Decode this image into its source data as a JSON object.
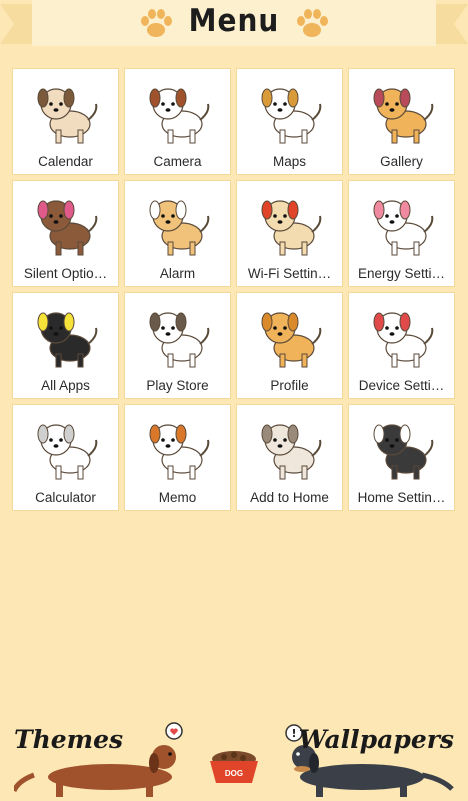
{
  "header": {
    "title": "Menu"
  },
  "tiles": [
    {
      "label": "Calendar",
      "icon": "pug-dog-icon",
      "fur": "#f1dcc0",
      "accent": "#7a5a3a"
    },
    {
      "label": "Camera",
      "icon": "papillon-dog-icon",
      "fur": "#ffffff",
      "accent": "#a0522d"
    },
    {
      "label": "Maps",
      "icon": "beagle-dog-icon",
      "fur": "#ffffff",
      "accent": "#d99a3a"
    },
    {
      "label": "Gallery",
      "icon": "shiba-dog-icon",
      "fur": "#f0b35a",
      "accent": "#b84a5a"
    },
    {
      "label": "Silent Optio…",
      "icon": "yorkie-dog-icon",
      "fur": "#8a5a3a",
      "accent": "#e05a8a"
    },
    {
      "label": "Alarm",
      "icon": "corgi-dog-icon",
      "fur": "#f0c27a",
      "accent": "#ffffff"
    },
    {
      "label": "Wi-Fi Settin…",
      "icon": "golden-retriever-dog-icon",
      "fur": "#f2dcb0",
      "accent": "#e0452a"
    },
    {
      "label": "Energy Setti…",
      "icon": "shih-tzu-dog-icon",
      "fur": "#ffffff",
      "accent": "#f08aa0"
    },
    {
      "label": "All Apps",
      "icon": "chihuahua-dog-icon",
      "fur": "#2a2a2a",
      "accent": "#f5e33a"
    },
    {
      "label": "Play Store",
      "icon": "fox-terrier-dog-icon",
      "fur": "#ffffff",
      "accent": "#6a5a4a"
    },
    {
      "label": "Profile",
      "icon": "pomeranian-dog-icon",
      "fur": "#f0b35a",
      "accent": "#d98a2a"
    },
    {
      "label": "Device Setti…",
      "icon": "poodle-dog-icon",
      "fur": "#ffffff",
      "accent": "#e04a4a"
    },
    {
      "label": "Calculator",
      "icon": "white-pomeranian-dog-icon",
      "fur": "#ffffff",
      "accent": "#cfcfcf"
    },
    {
      "label": "Memo",
      "icon": "jack-russell-dog-icon",
      "fur": "#ffffff",
      "accent": "#d9782a"
    },
    {
      "label": "Add to Home",
      "icon": "french-bulldog-dog-icon",
      "fur": "#efe6dc",
      "accent": "#9a8a7a"
    },
    {
      "label": "Home Settin…",
      "icon": "schnauzer-dog-icon",
      "fur": "#3a3a3a",
      "accent": "#ffffff"
    }
  ],
  "bottom": {
    "themes_label": "Themes",
    "wallpapers_label": "Wallpapers",
    "bowl_label": "DOG"
  },
  "colors": {
    "background": "#fde7b4",
    "ribbon": "#fdf0cf",
    "paw": "#f0b45a",
    "text": "#2b2b2b"
  }
}
